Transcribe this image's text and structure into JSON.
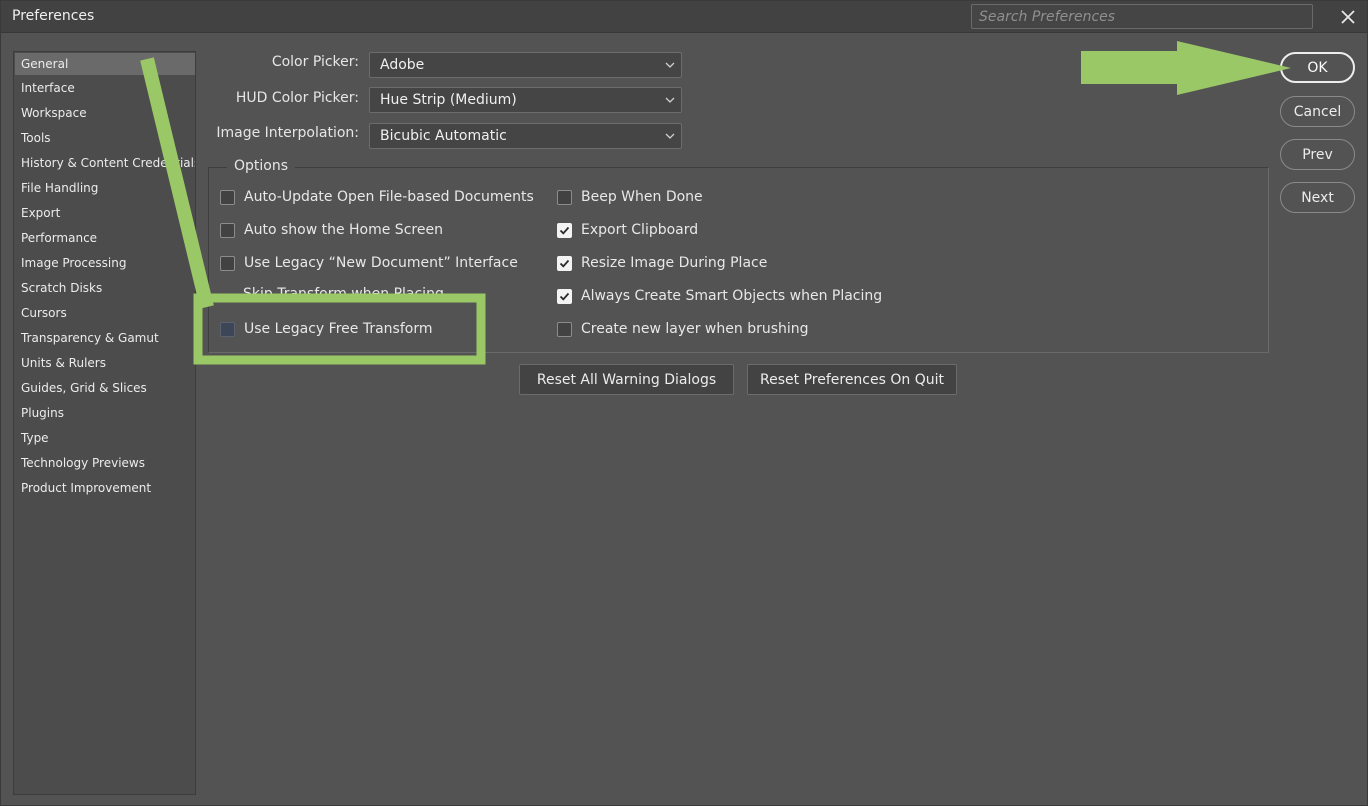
{
  "window": {
    "title": "Preferences",
    "search_placeholder": "Search Preferences"
  },
  "icons": {
    "close": "close-icon",
    "dropdown": "chevron-down-icon",
    "check": "checkmark-icon"
  },
  "sidebar": {
    "items": [
      {
        "label": "General",
        "selected": true
      },
      {
        "label": "Interface"
      },
      {
        "label": "Workspace"
      },
      {
        "label": "Tools"
      },
      {
        "label": "History & Content Credentials"
      },
      {
        "label": "File Handling"
      },
      {
        "label": "Export"
      },
      {
        "label": "Performance"
      },
      {
        "label": "Image Processing"
      },
      {
        "label": "Scratch Disks"
      },
      {
        "label": "Cursors"
      },
      {
        "label": "Transparency & Gamut"
      },
      {
        "label": "Units & Rulers"
      },
      {
        "label": "Guides, Grid & Slices"
      },
      {
        "label": "Plugins"
      },
      {
        "label": "Type"
      },
      {
        "label": "Technology Previews"
      },
      {
        "label": "Product Improvement"
      }
    ]
  },
  "fields": {
    "color_picker": {
      "label": "Color Picker:",
      "value": "Adobe"
    },
    "hud_color_picker": {
      "label": "HUD Color Picker:",
      "value": "Hue Strip (Medium)"
    },
    "image_interpolation": {
      "label": "Image Interpolation:",
      "value": "Bicubic Automatic"
    }
  },
  "options": {
    "legend": "Options",
    "left": [
      {
        "label": "Auto-Update Open File-based Documents",
        "checked": false
      },
      {
        "label": "Auto show the Home Screen",
        "checked": false
      },
      {
        "label": "Use Legacy “New Document” Interface",
        "checked": false
      },
      {
        "label": "Skip Transform when Placing",
        "checked": false
      },
      {
        "label": "Use Legacy Free Transform",
        "checked": false
      }
    ],
    "right": [
      {
        "label": "Beep When Done",
        "checked": false
      },
      {
        "label": "Export Clipboard",
        "checked": true
      },
      {
        "label": "Resize Image During Place",
        "checked": true
      },
      {
        "label": "Always Create Smart Objects when Placing",
        "checked": true
      },
      {
        "label": "Create new layer when brushing",
        "checked": false
      }
    ]
  },
  "buttons": {
    "reset_warnings": "Reset All Warning Dialogs",
    "reset_prefs": "Reset Preferences On Quit",
    "ok": "OK",
    "cancel": "Cancel",
    "prev": "Prev",
    "next": "Next"
  },
  "colors": {
    "annotation_green": "#9bc866",
    "background": "#535353"
  }
}
